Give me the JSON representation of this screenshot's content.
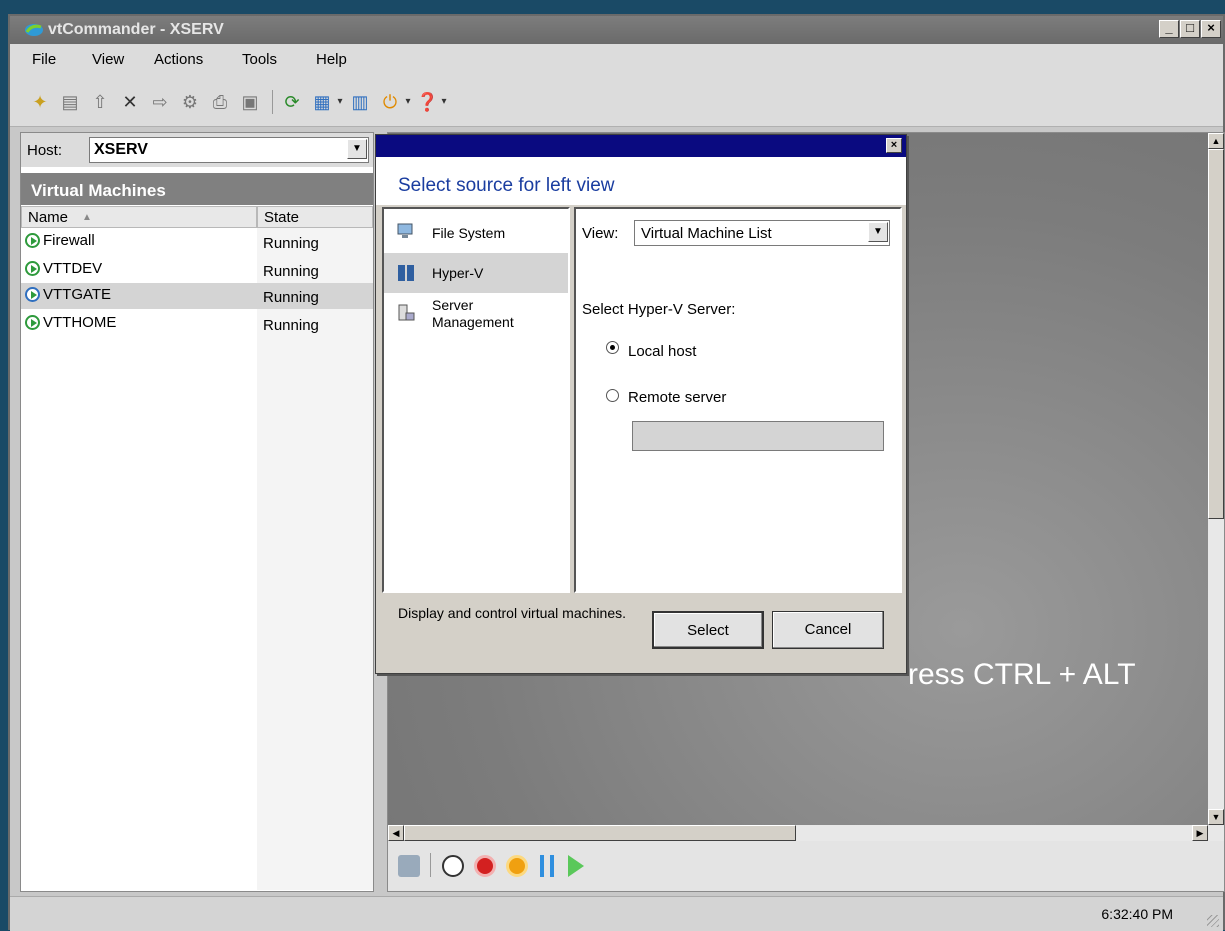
{
  "window": {
    "title": "vtCommander - XSERV",
    "controls": [
      "_",
      "□",
      "×"
    ]
  },
  "menu": [
    "File",
    "View",
    "Actions",
    "Tools",
    "Help"
  ],
  "host": {
    "label": "Host:",
    "value": "XSERV"
  },
  "vm_list": {
    "title": "Virtual Machines",
    "columns": [
      "Name",
      "State"
    ],
    "rows": [
      {
        "name": "Firewall",
        "state": "Running",
        "selected": false
      },
      {
        "name": "VTTDEV",
        "state": "Running",
        "selected": false
      },
      {
        "name": "VTTGATE",
        "state": "Running",
        "selected": true
      },
      {
        "name": "VTTHOME",
        "state": "Running",
        "selected": false
      }
    ]
  },
  "console": {
    "text": "ress CTRL + ALT"
  },
  "dialog": {
    "title": "Select source for left view",
    "sources": [
      {
        "label": "File System",
        "icon": "folder-computer-icon"
      },
      {
        "label": "Hyper-V",
        "icon": "server-icon",
        "selected": true
      },
      {
        "label": "Server Management",
        "line1": "Server",
        "line2": "Management",
        "icon": "server-management-icon"
      }
    ],
    "view_label": "View:",
    "view_value": "Virtual Machine List",
    "select_server_label": "Select Hyper-V Server:",
    "local_host": "Local host",
    "remote_server": "Remote server",
    "selected_option": "Local host",
    "remote_value": "",
    "description": "Display and control virtual machines.",
    "select_button": "Select",
    "cancel_button": "Cancel"
  },
  "status": {
    "time": "6:32:40 PM"
  },
  "colors": {
    "dialog_title": "#1a3da0",
    "titlebar_active": "#0a0a80",
    "running_green": "#2e9a3c"
  }
}
